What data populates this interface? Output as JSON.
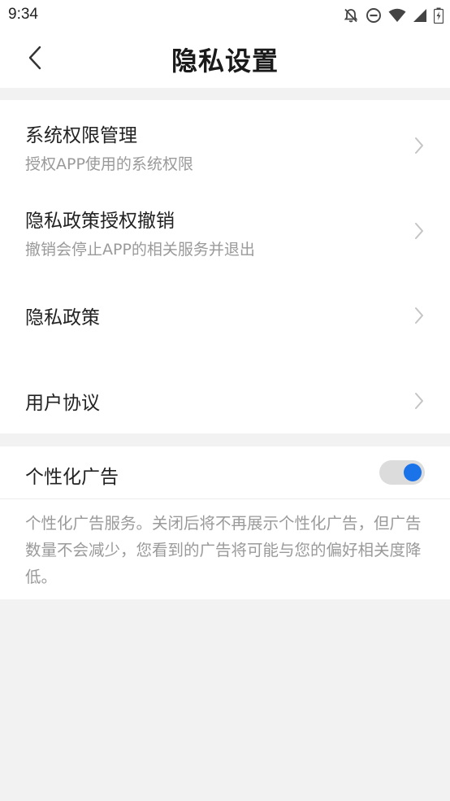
{
  "status_bar": {
    "time": "9:34",
    "icons": [
      "bell-off-icon",
      "do-not-disturb-icon",
      "wifi-icon",
      "cell-signal-icon",
      "battery-charging-icon"
    ]
  },
  "header": {
    "title": "隐私设置",
    "back_icon": "chevron-left-icon"
  },
  "settings": {
    "items": [
      {
        "title": "系统权限管理",
        "subtitle": "授权APP使用的系统权限"
      },
      {
        "title": "隐私政策授权撤销",
        "subtitle": "撤销会停止APP的相关服务并退出"
      },
      {
        "title": "隐私政策"
      },
      {
        "title": "用户协议"
      }
    ]
  },
  "ads": {
    "label": "个性化广告",
    "enabled": true,
    "accent_color": "#1a73e8",
    "description": "个性化广告服务。关闭后将不再展示个性化广告，但广告数量不会减少，您看到的广告将可能与您的偏好相关度降低。"
  }
}
